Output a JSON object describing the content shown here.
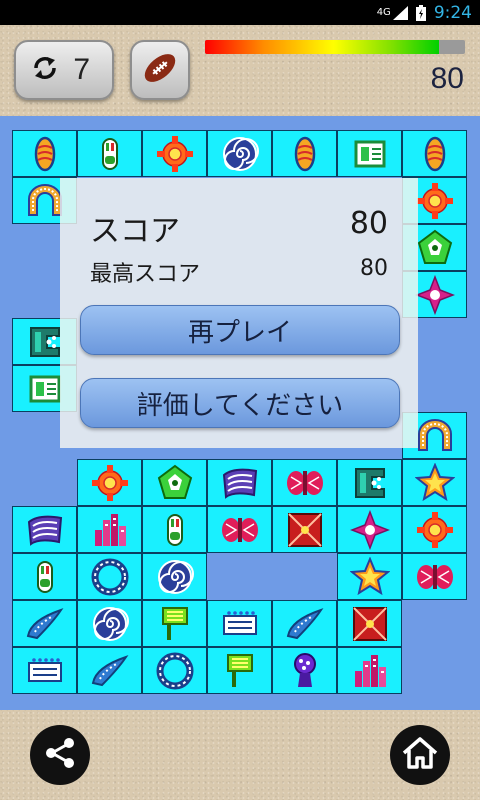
{
  "status_bar": {
    "network": "4G",
    "time": "9:24"
  },
  "controls": {
    "shuffle_count": "7",
    "timer_fraction": 0.9,
    "score": "80"
  },
  "dialog": {
    "score_label": "スコア",
    "score_value": "80",
    "best_label": "最高スコア",
    "best_value": "80",
    "replay_label": "再プレイ",
    "rate_label": "評価してください"
  },
  "board": {
    "tiles": [
      [
        0,
        0,
        "oval-leaf"
      ],
      [
        0,
        1,
        "footprint"
      ],
      [
        0,
        2,
        "sun-gear"
      ],
      [
        0,
        3,
        "spiral-shell"
      ],
      [
        0,
        4,
        "oval-leaf"
      ],
      [
        0,
        5,
        "circuit"
      ],
      [
        0,
        6,
        "oval-leaf"
      ],
      [
        1,
        0,
        "arch"
      ],
      [
        1,
        6,
        "sun-gear"
      ],
      [
        2,
        6,
        "pentagon-star"
      ],
      [
        3,
        6,
        "cross-flower"
      ],
      [
        4,
        0,
        "comb-block"
      ],
      [
        5,
        0,
        "circuit"
      ],
      [
        6,
        6,
        "arch"
      ],
      [
        7,
        1,
        "sun-gear"
      ],
      [
        7,
        2,
        "pentagon-star"
      ],
      [
        7,
        3,
        "book"
      ],
      [
        7,
        4,
        "butterfly"
      ],
      [
        7,
        5,
        "comb-block"
      ],
      [
        7,
        6,
        "star"
      ],
      [
        8,
        0,
        "book"
      ],
      [
        8,
        1,
        "buildings"
      ],
      [
        8,
        2,
        "footprint"
      ],
      [
        8,
        3,
        "butterfly"
      ],
      [
        8,
        4,
        "envelope"
      ],
      [
        8,
        5,
        "cross-flower"
      ],
      [
        8,
        6,
        "sun-gear"
      ],
      [
        9,
        0,
        "footprint"
      ],
      [
        9,
        1,
        "ring"
      ],
      [
        9,
        2,
        "spiral-shell"
      ],
      [
        9,
        5,
        "star"
      ],
      [
        9,
        6,
        "butterfly"
      ],
      [
        10,
        0,
        "horn"
      ],
      [
        10,
        1,
        "spiral-shell"
      ],
      [
        10,
        2,
        "flag"
      ],
      [
        10,
        3,
        "keyboard"
      ],
      [
        10,
        4,
        "horn"
      ],
      [
        10,
        5,
        "envelope"
      ],
      [
        11,
        0,
        "keyboard"
      ],
      [
        11,
        1,
        "horn"
      ],
      [
        11,
        2,
        "ring"
      ],
      [
        11,
        3,
        "flag"
      ],
      [
        11,
        4,
        "vase"
      ],
      [
        11,
        5,
        "buildings"
      ]
    ]
  },
  "icons": {
    "shuffle": "shuffle-arrows-icon",
    "football": "football-icon",
    "share": "share-icon",
    "home": "home-icon"
  },
  "colors": {
    "tile": "#19f0ff",
    "board_frame": "#6f9be6",
    "button_blue": "#7aa4e4"
  }
}
